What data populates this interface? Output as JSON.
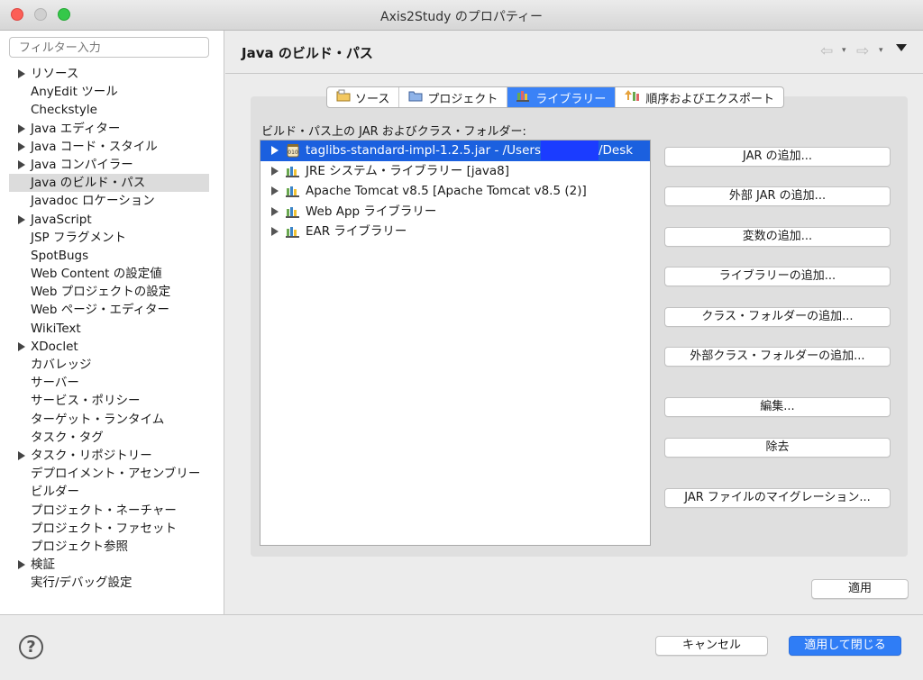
{
  "window": {
    "title": "Axis2Study のプロパティー"
  },
  "sidebar": {
    "filter_placeholder": "フィルター入力",
    "items": [
      {
        "label": "リソース",
        "expandable": true
      },
      {
        "label": "AnyEdit ツール",
        "expandable": false
      },
      {
        "label": "Checkstyle",
        "expandable": false
      },
      {
        "label": "Java エディター",
        "expandable": true
      },
      {
        "label": "Java コード・スタイル",
        "expandable": true
      },
      {
        "label": "Java コンパイラー",
        "expandable": true
      },
      {
        "label": "Java のビルド・パス",
        "expandable": false,
        "selected": true
      },
      {
        "label": "Javadoc ロケーション",
        "expandable": false
      },
      {
        "label": "JavaScript",
        "expandable": true
      },
      {
        "label": "JSP フラグメント",
        "expandable": false
      },
      {
        "label": "SpotBugs",
        "expandable": false
      },
      {
        "label": "Web Content の設定値",
        "expandable": false
      },
      {
        "label": "Web プロジェクトの設定",
        "expandable": false
      },
      {
        "label": "Web ページ・エディター",
        "expandable": false
      },
      {
        "label": "WikiText",
        "expandable": false
      },
      {
        "label": "XDoclet",
        "expandable": true
      },
      {
        "label": "カバレッジ",
        "expandable": false
      },
      {
        "label": "サーバー",
        "expandable": false
      },
      {
        "label": "サービス・ポリシー",
        "expandable": false
      },
      {
        "label": "ターゲット・ランタイム",
        "expandable": false
      },
      {
        "label": "タスク・タグ",
        "expandable": false
      },
      {
        "label": "タスク・リポジトリー",
        "expandable": true
      },
      {
        "label": "デプロイメント・アセンブリー",
        "expandable": false
      },
      {
        "label": "ビルダー",
        "expandable": false
      },
      {
        "label": "プロジェクト・ネーチャー",
        "expandable": false
      },
      {
        "label": "プロジェクト・ファセット",
        "expandable": false
      },
      {
        "label": "プロジェクト参照",
        "expandable": false
      },
      {
        "label": "検証",
        "expandable": true
      },
      {
        "label": "実行/デバッグ設定",
        "expandable": false
      }
    ]
  },
  "page": {
    "title": "Java のビルド・パス",
    "nav": {
      "back_icon": "⇦",
      "forward_icon": "⇨",
      "dropdown_icon": "▾"
    }
  },
  "tabs": [
    {
      "label": "ソース",
      "icon": "source-folder-icon",
      "active": false
    },
    {
      "label": "プロジェクト",
      "icon": "project-folder-icon",
      "active": false
    },
    {
      "label": "ライブラリー",
      "icon": "library-icon",
      "active": true
    },
    {
      "label": "順序およびエクスポート",
      "icon": "order-export-icon",
      "active": false
    }
  ],
  "libraries": {
    "label": "ビルド・パス上の JAR およびクラス・フォルダー:",
    "items": [
      {
        "prefix": "taglibs-standard-impl-1.2.5.jar - /Users",
        "suffix": "/Desk",
        "icon": "jar-icon",
        "selected": true
      },
      {
        "prefix": "JRE システム・ライブラリー [java8]",
        "suffix": "",
        "icon": "library-icon",
        "selected": false
      },
      {
        "prefix": "Apache Tomcat v8.5 [Apache Tomcat v8.5 (2)]",
        "suffix": "",
        "icon": "library-icon",
        "selected": false
      },
      {
        "prefix": "Web App ライブラリー",
        "suffix": "",
        "icon": "library-icon",
        "selected": false
      },
      {
        "prefix": "EAR ライブラリー",
        "suffix": "",
        "icon": "library-icon",
        "selected": false
      }
    ]
  },
  "buttons": {
    "add_jar": "JAR の追加...",
    "add_external_jar": "外部 JAR の追加...",
    "add_variable": "変数の追加...",
    "add_library": "ライブラリーの追加...",
    "add_class_folder": "クラス・フォルダーの追加...",
    "add_external_class_folder": "外部クラス・フォルダーの追加...",
    "edit": "編集...",
    "remove": "除去",
    "migrate_jar": "JAR ファイルのマイグレーション...",
    "apply": "適用",
    "cancel": "キャンセル",
    "apply_and_close": "適用して閉じる"
  },
  "help": {
    "icon": "?"
  },
  "colors": {
    "accent": "#2f7df6",
    "selection": "#1b60df",
    "redaction": "#1b3cff"
  }
}
